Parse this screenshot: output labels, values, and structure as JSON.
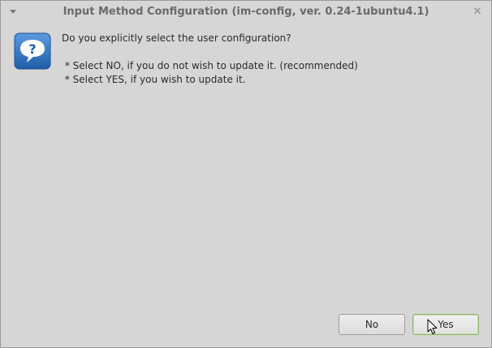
{
  "window": {
    "title": "Input Method Configuration (im-config, ver. 0.24-1ubuntu4.1)"
  },
  "dialog": {
    "icon": "question-icon",
    "question": "Do you explicitly select the user configuration?",
    "lines": [
      " * Select NO, if you do not wish to update it. (recommended)",
      " * Select YES, if you wish to update it."
    ]
  },
  "buttons": {
    "no_label": "No",
    "yes_label": "Yes"
  },
  "colors": {
    "background": "#d6d6d6",
    "icon_blue": "#2f6fb8",
    "yes_focus_border": "#8fb56a"
  }
}
